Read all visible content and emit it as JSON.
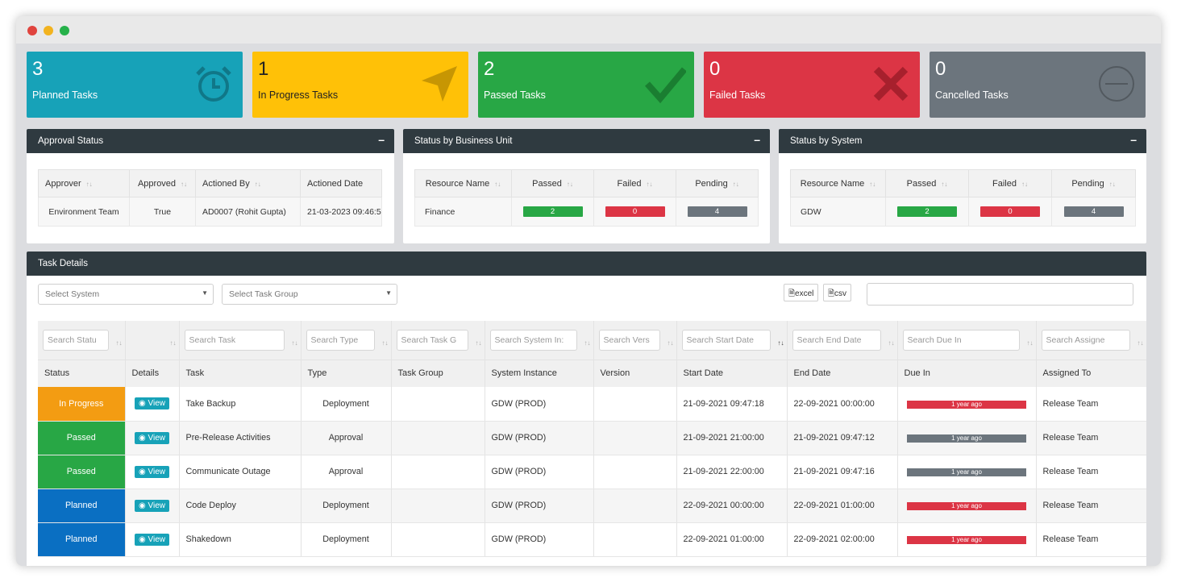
{
  "window": {
    "dots": [
      "#e0443e",
      "#f2b31f",
      "#26b14a"
    ]
  },
  "kpis": [
    {
      "count": "3",
      "label": "Planned Tasks",
      "color": "#17a2b8",
      "icon": "alarm-clock-icon"
    },
    {
      "count": "1",
      "label": "In Progress Tasks",
      "color": "#ffc107",
      "icon": "paper-plane-icon"
    },
    {
      "count": "2",
      "label": "Passed Tasks",
      "color": "#28a745",
      "icon": "check-icon"
    },
    {
      "count": "0",
      "label": "Failed Tasks",
      "color": "#dc3545",
      "icon": "cross-icon"
    },
    {
      "count": "0",
      "label": "Cancelled Tasks",
      "color": "#6c757d",
      "icon": "minus-circle-icon"
    }
  ],
  "approval": {
    "title": "Approval Status",
    "collapse": "–",
    "columns": [
      "Approver",
      "Approved",
      "Actioned By",
      "Actioned Date"
    ],
    "rows": [
      [
        "Environment Team",
        "True",
        "AD0007 (Rohit Gupta)",
        "21-03-2023 09:46:5"
      ]
    ]
  },
  "business_unit": {
    "title": "Status by Business Unit",
    "collapse": "–",
    "columns": [
      "Resource Name",
      "Passed",
      "Failed",
      "Pending"
    ],
    "rows": [
      {
        "name": "Finance",
        "passed": "2",
        "failed": "0",
        "pending": "4"
      }
    ]
  },
  "system": {
    "title": "Status by System",
    "collapse": "–",
    "columns": [
      "Resource Name",
      "Passed",
      "Failed",
      "Pending"
    ],
    "rows": [
      {
        "name": "GDW",
        "passed": "2",
        "failed": "0",
        "pending": "4"
      }
    ]
  },
  "colors": {
    "passed": "#28a745",
    "failed": "#dc3545",
    "pending": "#6c757d",
    "in_progress": "#f39c12",
    "planned": "#0a6fc2"
  },
  "tasks": {
    "title": "Task Details",
    "select_system": "Select System",
    "select_task_group": "Select Task Group",
    "excel_label": "excel",
    "csv_label": "csv",
    "filters": [
      "Search Statu",
      "",
      "Search Task",
      "Search Type",
      "Search Task G",
      "Search System In:",
      "Search Vers",
      "Search Start Date",
      "Search End Date",
      "Search Due In",
      "Search Assigne"
    ],
    "columns": [
      "Status",
      "Details",
      "Task",
      "Type",
      "Task Group",
      "System Instance",
      "Version",
      "Start Date",
      "End Date",
      "Due In",
      "Assigned To"
    ],
    "view_label": "View",
    "rows": [
      {
        "status": "In Progress",
        "status_color": "#f39c12",
        "task": "Take Backup",
        "type": "Deployment",
        "group": "",
        "instance": "GDW (PROD)",
        "version": "",
        "start": "21-09-2021 09:47:18",
        "end": "22-09-2021 00:00:00",
        "due": "1 year ago",
        "due_color": "#dc3545",
        "assigned": "Release Team"
      },
      {
        "status": "Passed",
        "status_color": "#28a745",
        "task": "Pre-Release Activities",
        "type": "Approval",
        "group": "",
        "instance": "GDW (PROD)",
        "version": "",
        "start": "21-09-2021 21:00:00",
        "end": "21-09-2021 09:47:12",
        "due": "1 year ago",
        "due_color": "#6c757d",
        "assigned": "Release Team"
      },
      {
        "status": "Passed",
        "status_color": "#28a745",
        "task": "Communicate Outage",
        "type": "Approval",
        "group": "",
        "instance": "GDW (PROD)",
        "version": "",
        "start": "21-09-2021 22:00:00",
        "end": "21-09-2021 09:47:16",
        "due": "1 year ago",
        "due_color": "#6c757d",
        "assigned": "Release Team"
      },
      {
        "status": "Planned",
        "status_color": "#0a6fc2",
        "task": "Code Deploy",
        "type": "Deployment",
        "group": "",
        "instance": "GDW (PROD)",
        "version": "",
        "start": "22-09-2021 00:00:00",
        "end": "22-09-2021 01:00:00",
        "due": "1 year ago",
        "due_color": "#dc3545",
        "assigned": "Release Team"
      },
      {
        "status": "Planned",
        "status_color": "#0a6fc2",
        "task": "Shakedown",
        "type": "Deployment",
        "group": "",
        "instance": "GDW (PROD)",
        "version": "",
        "start": "22-09-2021 01:00:00",
        "end": "22-09-2021 02:00:00",
        "due": "1 year ago",
        "due_color": "#dc3545",
        "assigned": "Release Team"
      }
    ]
  }
}
